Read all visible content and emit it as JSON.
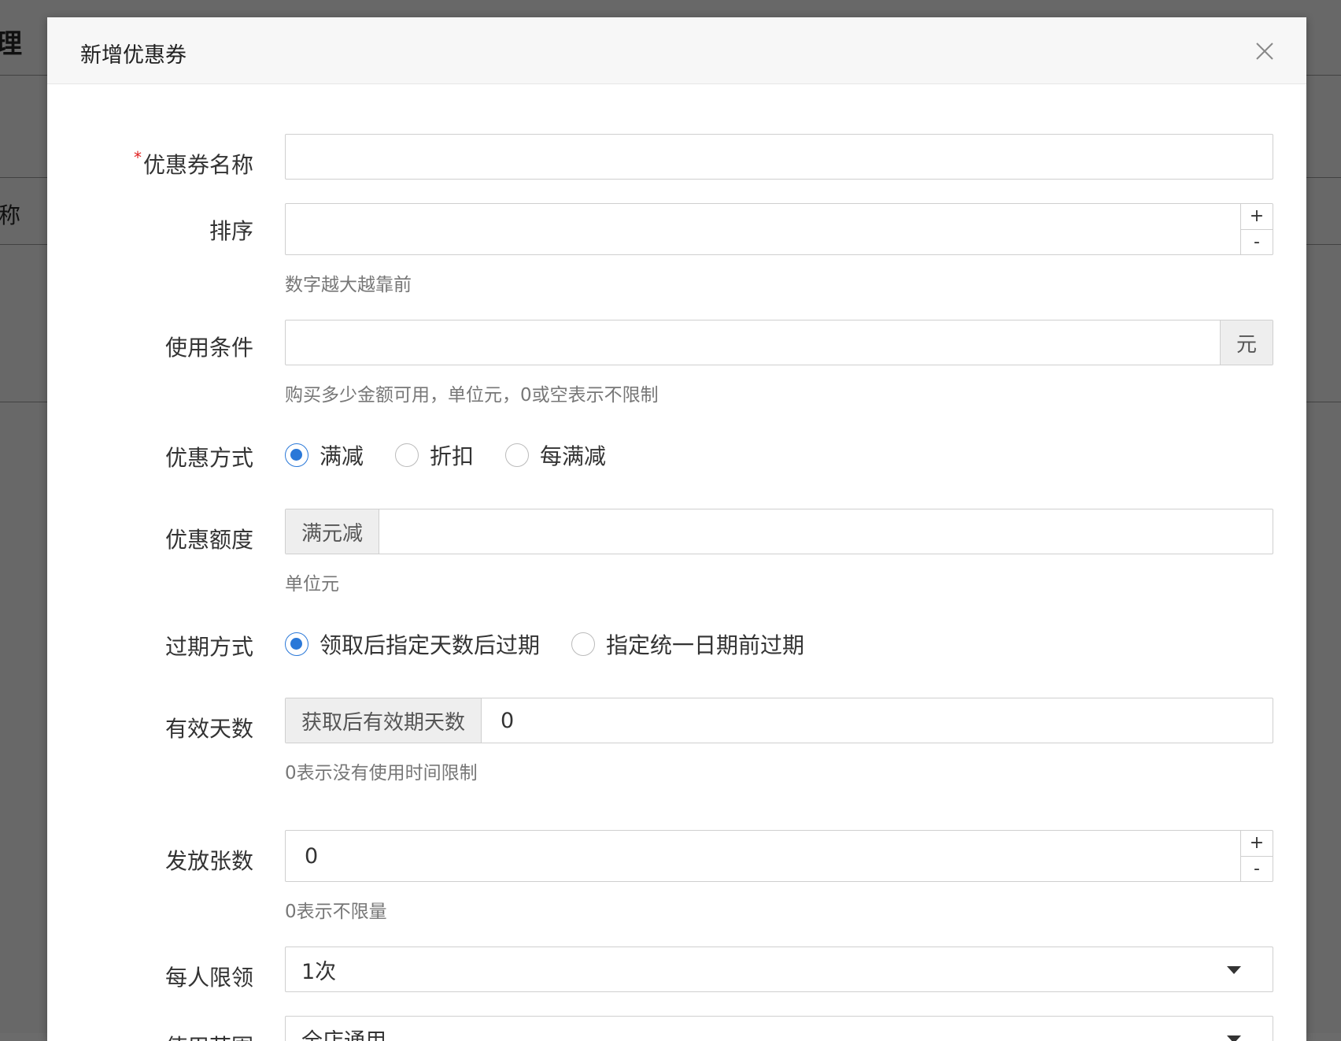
{
  "background": {
    "heading_fragment": "理",
    "column_fragment": "称"
  },
  "modal": {
    "title": "新增优惠券",
    "fields": {
      "name": {
        "required_mark": "*",
        "label": "优惠券名称",
        "value": ""
      },
      "sort": {
        "label": "排序",
        "value": "",
        "help": "数字越大越靠前",
        "plus": "+",
        "minus": "-"
      },
      "condition": {
        "label": "使用条件",
        "value": "",
        "suffix": "元",
        "help": "购买多少金额可用，单位元，0或空表示不限制"
      },
      "discount_type": {
        "label": "优惠方式",
        "options": [
          "满减",
          "折扣",
          "每满减"
        ],
        "selected": "满减"
      },
      "discount_amount": {
        "label": "优惠额度",
        "prefix": "满元减",
        "value": "",
        "help": "单位元"
      },
      "expire_type": {
        "label": "过期方式",
        "options": [
          "领取后指定天数后过期",
          "指定统一日期前过期"
        ],
        "selected": "领取后指定天数后过期"
      },
      "valid_days": {
        "label": "有效天数",
        "prefix": "获取后有效期天数",
        "value": "0",
        "help": "0表示没有使用时间限制"
      },
      "issue_count": {
        "label": "发放张数",
        "value": "0",
        "help": "0表示不限量",
        "plus": "+",
        "minus": "-"
      },
      "per_user_limit": {
        "label": "每人限领",
        "value": "1次"
      },
      "scope": {
        "label": "使用范围",
        "value": "全店通用"
      }
    }
  }
}
